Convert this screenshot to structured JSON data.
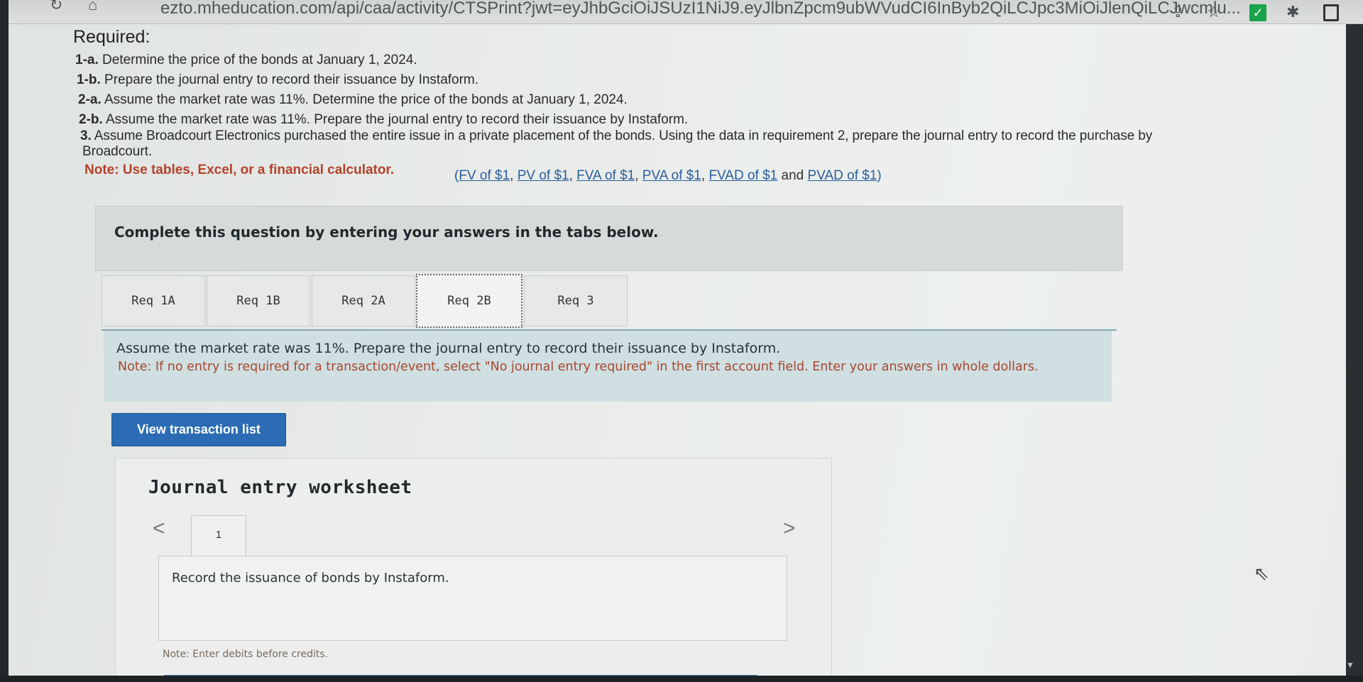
{
  "browser": {
    "url": "ezto.mheducation.com/api/caa/activity/CTSPrint?jwt=eyJhbGciOiJSUzI1NiJ9.eyJlbnZpcm9ubWVudCI6InByb2QiLCJpc3MiOiJlenQiLCJwcmlu...",
    "icons": [
      "share-icon",
      "star-icon",
      "check-extension-icon",
      "puzzle-icon",
      "window-icon"
    ]
  },
  "required": {
    "title": "Required:",
    "items": [
      {
        "label": "1-a.",
        "text": " Determine the price of the bonds at January 1, 2024."
      },
      {
        "label": "1-b.",
        "text": " Prepare the journal entry to record their issuance by Instaform."
      },
      {
        "label": "2-a.",
        "text": " Assume the market rate was 11%. Determine the price of the bonds at January 1, 2024."
      },
      {
        "label": "2-b.",
        "text": " Assume the market rate was 11%. Prepare the journal entry to record their issuance by Instaform."
      },
      {
        "label": "3.",
        "text": " Assume Broadcourt Electronics purchased the entire issue in a private placement of the bonds. Using the data in requirement 2, prepare the journal entry to record the purchase by"
      },
      {
        "label": "",
        "text": "Broadcourt."
      }
    ],
    "note": "Note: Use tables, Excel, or a financial calculator.",
    "links_open": "(",
    "links": [
      "FV of $1",
      "PV of $1",
      "FVA of $1",
      "PVA of $1",
      "FVAD of $1",
      "PVAD of $1"
    ],
    "links_and": "and",
    "links_close": ")"
  },
  "complete_box": {
    "text": "Complete this question by entering your answers in the tabs below."
  },
  "tabs": [
    {
      "label": "Req 1A",
      "active": false
    },
    {
      "label": "Req 1B",
      "active": false
    },
    {
      "label": "Req 2A",
      "active": false
    },
    {
      "label": "Req 2B",
      "active": true
    },
    {
      "label": "Req 3",
      "active": false
    }
  ],
  "instructions": {
    "main": "Assume the market rate was 11%. Prepare the journal entry to record their issuance by Instaform.",
    "note": "Note: If no entry is required for a transaction/event, select \"No journal entry required\" in the first account field. Enter your answers in whole dollars."
  },
  "view_button": {
    "label": "View transaction list"
  },
  "worksheet": {
    "title": "Journal entry worksheet",
    "prev": "<",
    "next": ">",
    "current_tab": "1",
    "record_text": "Record the issuance of bonds by Instaform.",
    "note": "Note: Enter debits before credits."
  },
  "colors": {
    "note_red": "#b4422a",
    "link_blue": "#2a5e9b",
    "button_blue": "#2b6cb4",
    "instruction_bg": "#cfdfe2"
  }
}
